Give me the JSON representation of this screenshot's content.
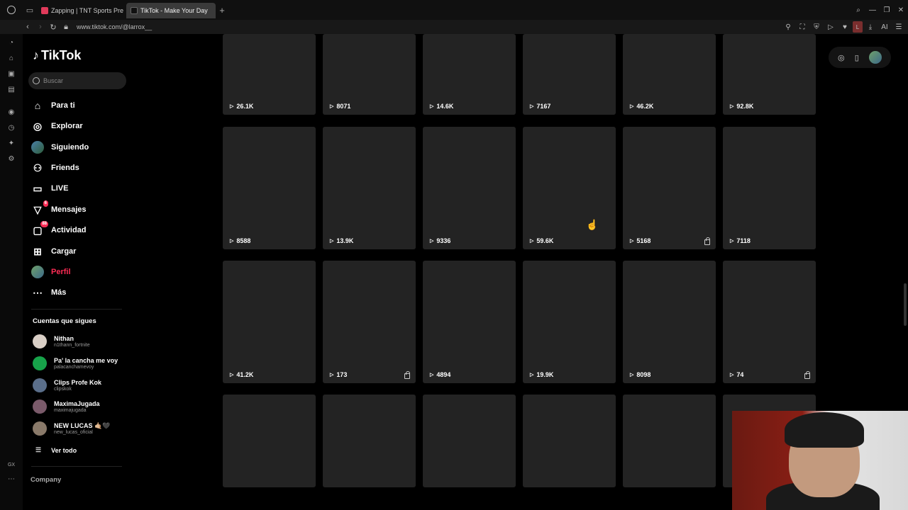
{
  "browser": {
    "tabs": [
      {
        "title": "Zapping | TNT Sports Pre",
        "active": false
      },
      {
        "title": "TikTok - Make Your Day",
        "active": true
      }
    ],
    "url": "www.tiktok.com/@larrox__",
    "gx_label": "GX"
  },
  "sidebar": {
    "logo": "TikTok",
    "search_placeholder": "Buscar",
    "menu": [
      {
        "label": "Para ti",
        "icon": "home-icon"
      },
      {
        "label": "Explorar",
        "icon": "compass-icon"
      },
      {
        "label": "Siguiendo",
        "icon": "following-avatar-icon"
      },
      {
        "label": "Friends",
        "icon": "friends-icon"
      },
      {
        "label": "LIVE",
        "icon": "live-icon"
      },
      {
        "label": "Mensajes",
        "icon": "messages-icon",
        "badge": "6"
      },
      {
        "label": "Actividad",
        "icon": "activity-icon",
        "badge": "88"
      },
      {
        "label": "Cargar",
        "icon": "upload-icon"
      },
      {
        "label": "Perfil",
        "icon": "profile-avatar-icon",
        "active": true
      },
      {
        "label": "Más",
        "icon": "more-icon"
      }
    ],
    "following_title": "Cuentas que sigues",
    "following": [
      {
        "name": "Nithan",
        "handle": "n1thann_fortnite",
        "color": "#d9cfc6"
      },
      {
        "name": "Pa' la cancha me voy",
        "handle": "palacanchamevoy",
        "color": "#17a34a"
      },
      {
        "name": "Clips Profe Kok",
        "handle": "clipskok",
        "color": "#5a6e8a"
      },
      {
        "name": "MaximaJugada",
        "handle": "maximajugada",
        "color": "#7a5a6a"
      },
      {
        "name": "NEW LUCAS 🤙🏼🖤",
        "handle": "new_lucas_oficial",
        "color": "#8a7a6a"
      }
    ],
    "see_all": "Ver todo",
    "company": "Company"
  },
  "videos": [
    {
      "views": "26.1K",
      "locked": false
    },
    {
      "views": "8071",
      "locked": false
    },
    {
      "views": "14.6K",
      "locked": false
    },
    {
      "views": "7167",
      "locked": false
    },
    {
      "views": "46.2K",
      "locked": false
    },
    {
      "views": "92.8K",
      "locked": false
    },
    {
      "views": "8588",
      "locked": false
    },
    {
      "views": "13.9K",
      "locked": false
    },
    {
      "views": "9336",
      "locked": false
    },
    {
      "views": "59.6K",
      "locked": false
    },
    {
      "views": "5168",
      "locked": true
    },
    {
      "views": "7118",
      "locked": false
    },
    {
      "views": "41.2K",
      "locked": false
    },
    {
      "views": "173",
      "locked": true
    },
    {
      "views": "4894",
      "locked": false
    },
    {
      "views": "19.9K",
      "locked": false
    },
    {
      "views": "8098",
      "locked": false
    },
    {
      "views": "74",
      "locked": true
    },
    {
      "views": "",
      "locked": false
    },
    {
      "views": "",
      "locked": false
    },
    {
      "views": "",
      "locked": false
    },
    {
      "views": "",
      "locked": false
    },
    {
      "views": "",
      "locked": false
    },
    {
      "views": "",
      "locked": false
    }
  ]
}
